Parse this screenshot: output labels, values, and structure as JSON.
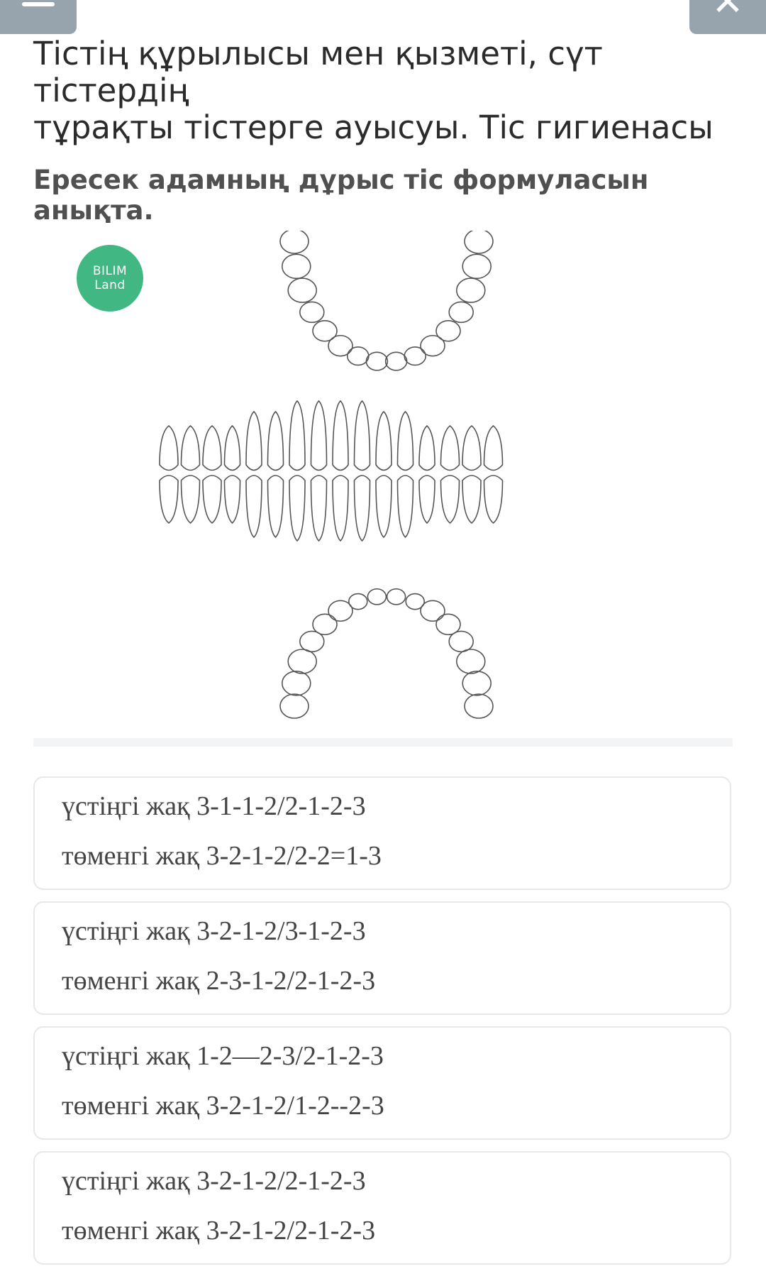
{
  "header": {
    "menu_icon": "hamburger-icon",
    "close_icon": "close-icon",
    "close_glyph": "✕"
  },
  "lesson": {
    "title_line1": "Тістің құрылысы мен қызметі, сүт тістердің",
    "title_line2": "тұрақты тістерге ауысуы. Тіс гигиенасы"
  },
  "question": {
    "text": "Ересек адамның дұрыс тіс формуласын анықта."
  },
  "image": {
    "badge_line1": "BILIM",
    "badge_line2": "Land",
    "badge_color": "#41b883"
  },
  "options": [
    {
      "line1": "үстіңгі жақ 3-1-1-2/2-1-2-3",
      "line2": "төменгі жақ 3-2-1-2/2-2=1-3"
    },
    {
      "line1": "үстіңгі жақ 3-2-1-2/3-1-2-3",
      "line2": "төменгі жақ 2-3-1-2/2-1-2-3"
    },
    {
      "line1": "үстіңгі жақ 1-2—2-3/2-1-2-3",
      "line2": "төменгі жақ 3-2-1-2/1-2--2-3"
    },
    {
      "line1": "үстіңгі жақ 3-2-1-2/2-1-2-3",
      "line2": "төменгі жақ 3-2-1-2/2-1-2-3"
    }
  ]
}
